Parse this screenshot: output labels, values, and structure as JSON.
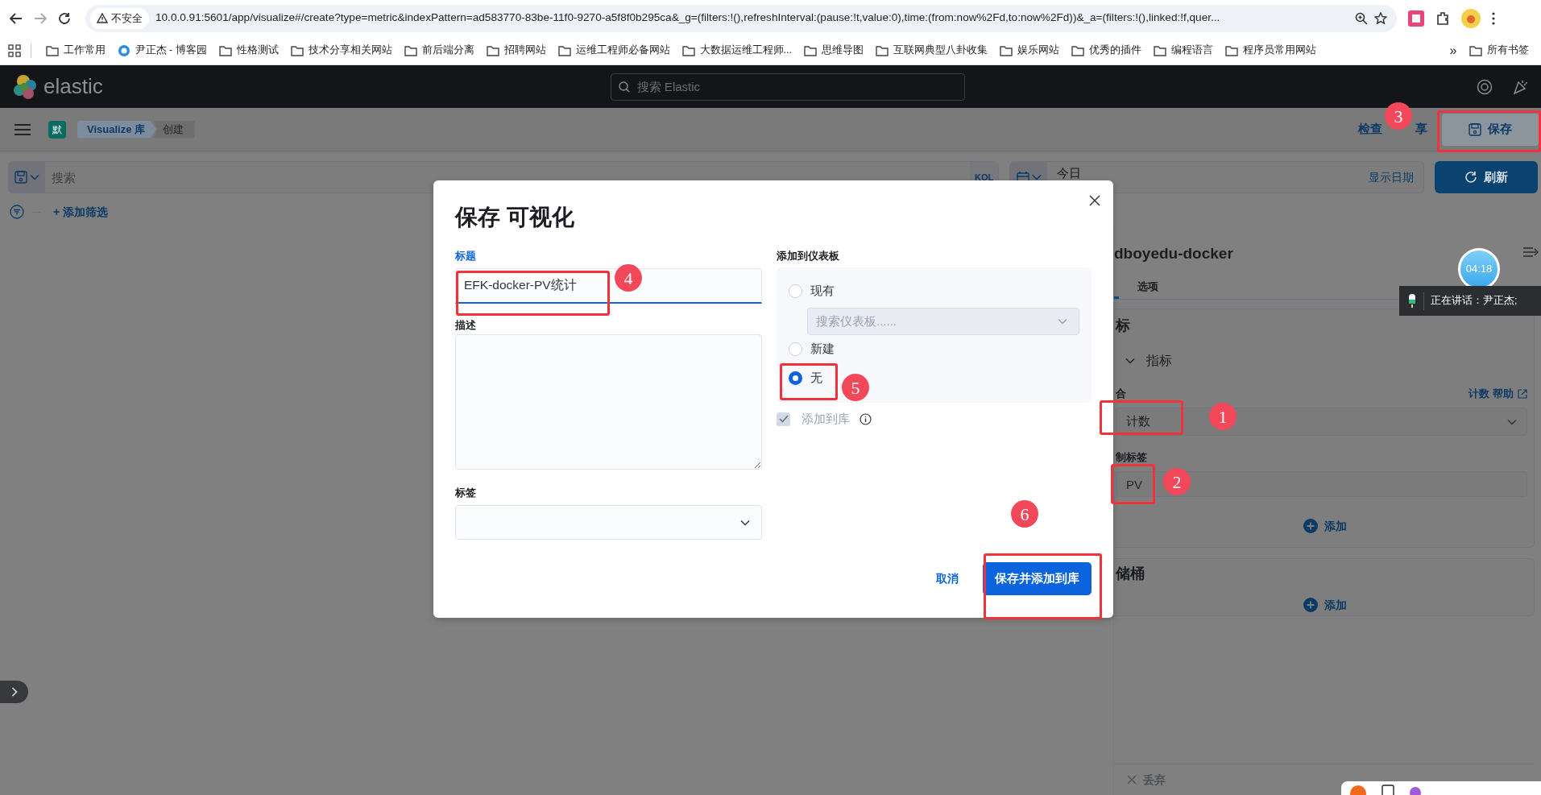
{
  "browser": {
    "security_label": "不安全",
    "url": "10.0.0.91:5601/app/visualize#/create?type=metric&indexPattern=ad583770-83be-11f0-9270-a5f8f0b295ca&_g=(filters:!(),refreshInterval:(pause:!t,value:0),time:(from:now%2Fd,to:now%2Fd))&_a=(filters:!(),linked:!f,quer...",
    "bookmarks": [
      {
        "label": "工作常用",
        "kind": "folder"
      },
      {
        "label": "尹正杰 - 博客园",
        "kind": "site"
      },
      {
        "label": "性格测试",
        "kind": "folder"
      },
      {
        "label": "技术分享相关网站",
        "kind": "folder"
      },
      {
        "label": "前后端分离",
        "kind": "folder"
      },
      {
        "label": "招聘网站",
        "kind": "folder"
      },
      {
        "label": "运维工程师必备网站",
        "kind": "folder"
      },
      {
        "label": "大数据运维工程师...",
        "kind": "folder"
      },
      {
        "label": "思维导图",
        "kind": "folder"
      },
      {
        "label": "互联网典型八卦收集",
        "kind": "folder"
      },
      {
        "label": "娱乐网站",
        "kind": "folder"
      },
      {
        "label": "优秀的插件",
        "kind": "folder"
      },
      {
        "label": "编程语言",
        "kind": "folder"
      },
      {
        "label": "程序员常用网站",
        "kind": "folder"
      }
    ],
    "overflow": "»",
    "all_bookmarks": "所有书签"
  },
  "header": {
    "logo_text": "elastic",
    "search_placeholder": "搜索 Elastic"
  },
  "toolbar": {
    "space_badge": "默",
    "breadcrumbs": [
      {
        "label": "Visualize 库",
        "selected": false
      },
      {
        "label": "创建",
        "selected": true
      }
    ],
    "links": [
      "检查",
      "享"
    ],
    "save_button": "保存"
  },
  "query_bar": {
    "placeholder": "搜索",
    "language": "KQL",
    "date": "今日",
    "show_dates": "显示日期",
    "refresh_button": "刷新"
  },
  "filter_bar": {
    "add_filter": "+ 添加筛选"
  },
  "side_panel": {
    "title": "dboyedu-docker",
    "tabs": [
      {
        "label": "选项",
        "selected": false
      }
    ],
    "metrics": {
      "heading": "标",
      "accordion_label": "指标",
      "expanded": true,
      "aggregation_label": "合",
      "help_link": "计数 帮助",
      "aggregation_value": "计数",
      "custom_label_label": "制标签",
      "custom_label_value": "PV",
      "add_button": "添加"
    },
    "buckets": {
      "heading": "储桶",
      "add_button": "添加"
    },
    "discard": "丢弃"
  },
  "modal": {
    "title": "保存 可视化",
    "title_label": "标题",
    "title_value": "EFK-docker-PV统计",
    "description_label": "描述",
    "tags_label": "标签",
    "dashboard_label": "添加到仪表板",
    "dashboard_options": [
      {
        "label": "现有",
        "selected": false,
        "select_placeholder": "搜索仪表板......"
      },
      {
        "label": "新建",
        "selected": false
      },
      {
        "label": "无",
        "selected": true
      }
    ],
    "add_to_library": {
      "label": "添加到库",
      "checked": true,
      "disabled": true
    },
    "cancel": "取消",
    "confirm": "保存并添加到库"
  },
  "annotations": [
    {
      "number": "1"
    },
    {
      "number": "2"
    },
    {
      "number": "3"
    },
    {
      "number": "4"
    },
    {
      "number": "5"
    },
    {
      "number": "6"
    }
  ],
  "meeting": {
    "timer": "04:18",
    "speaking": "正在讲话：尹正杰;"
  }
}
